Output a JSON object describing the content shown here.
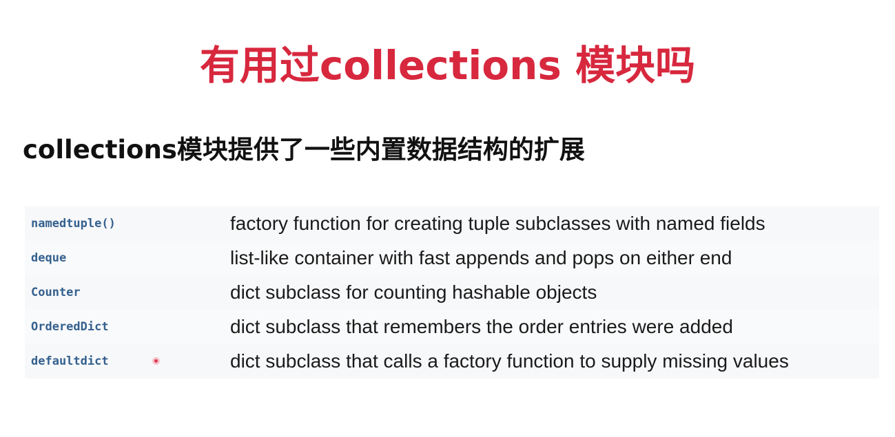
{
  "slide": {
    "title": "有用过collections 模块吗",
    "subtitle": "collections模块提供了一些内置数据结构的扩展"
  },
  "table": {
    "rows": [
      {
        "name": "namedtuple()",
        "description": "factory function for creating tuple subclasses with named fields"
      },
      {
        "name": "deque",
        "description": "list-like container with fast appends and pops on either end"
      },
      {
        "name": "Counter",
        "description": "dict subclass for counting hashable objects"
      },
      {
        "name": "OrderedDict",
        "description": "dict subclass that remembers the order entries were added"
      },
      {
        "name": "defaultdict",
        "description": "dict subclass that calls a factory function to supply missing values"
      }
    ]
  },
  "colors": {
    "title": "#d7283e",
    "subtitle": "#111111",
    "code_name": "#34608e",
    "table_background": "#f7f8fa",
    "pointer": "#d93a55"
  }
}
